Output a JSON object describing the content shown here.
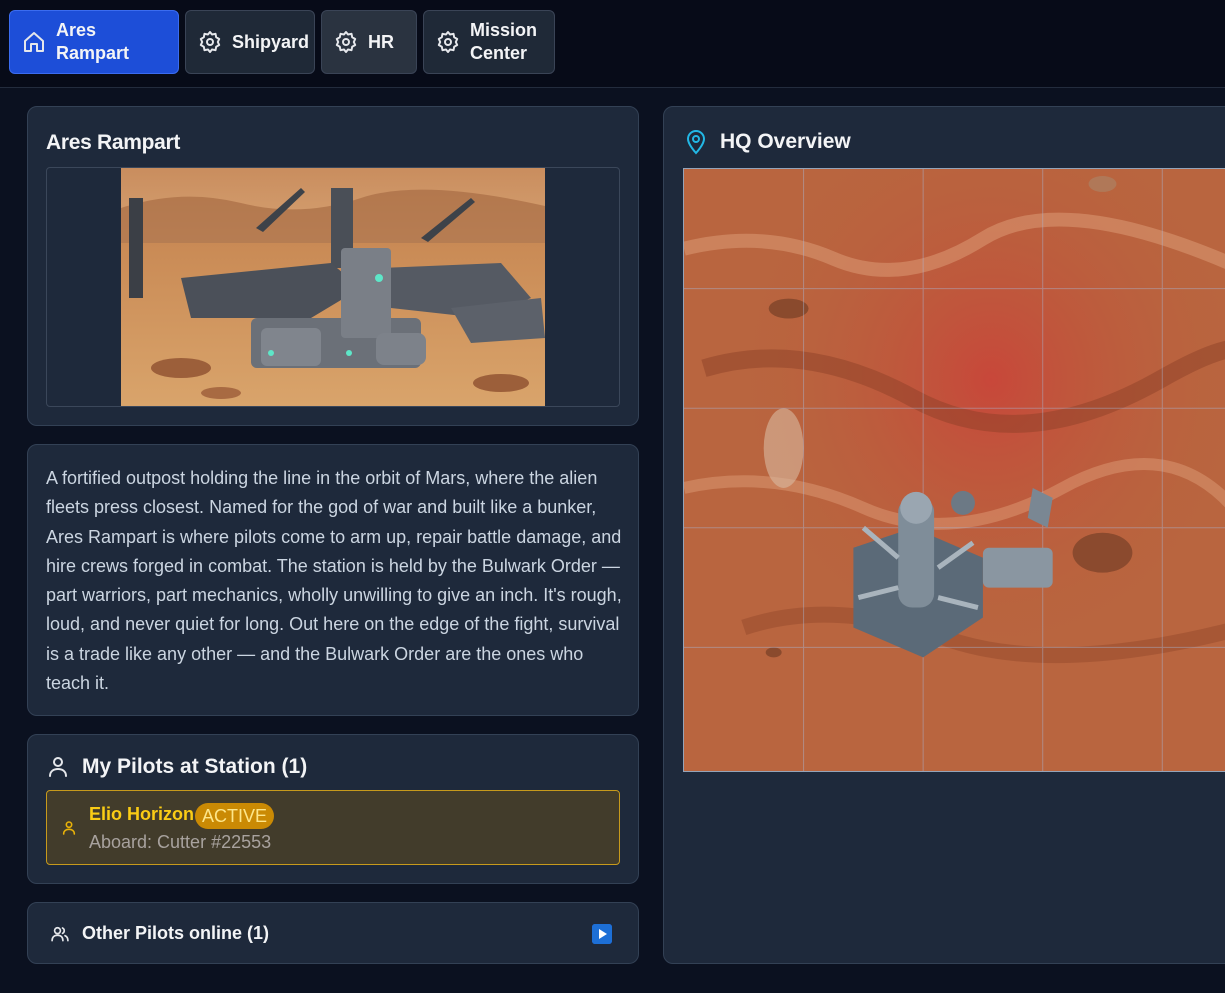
{
  "nav": {
    "tabs": [
      {
        "label": "Ares Rampart",
        "icon": "home-icon",
        "active": true
      },
      {
        "label": "Shipyard",
        "icon": "gear-icon"
      },
      {
        "label": "HR",
        "icon": "gear-icon"
      },
      {
        "label": "Mission Center",
        "icon": "gear-icon"
      }
    ]
  },
  "station": {
    "title": "Ares Rampart",
    "description": "A fortified outpost holding the line in the orbit of Mars, where the alien fleets press closest. Named for the god of war and built like a bunker, Ares Rampart is where pilots come to arm up, repair battle damage, and hire crews forged in combat. The station is held by the Bulwark Order — part warriors, part mechanics, wholly unwilling to give an inch. It's rough, loud, and never quiet for long. Out here on the edge of the fight, survival is a trade like any other — and the Bulwark Order are the ones who teach it."
  },
  "my_pilots": {
    "title": "My Pilots at Station (1)",
    "pilots": [
      {
        "name": "Elio Horizon",
        "status": "ACTIVE",
        "location": "Aboard: Cutter #22553"
      }
    ]
  },
  "other_pilots": {
    "title": "Other Pilots online (1)"
  },
  "hq": {
    "title": "HQ Overview"
  },
  "colors": {
    "accent": "#1d4ed8",
    "active_gold": "#facc15",
    "badge": "#ca8a04",
    "panel": "#1e293b",
    "background": "#0b1120"
  }
}
